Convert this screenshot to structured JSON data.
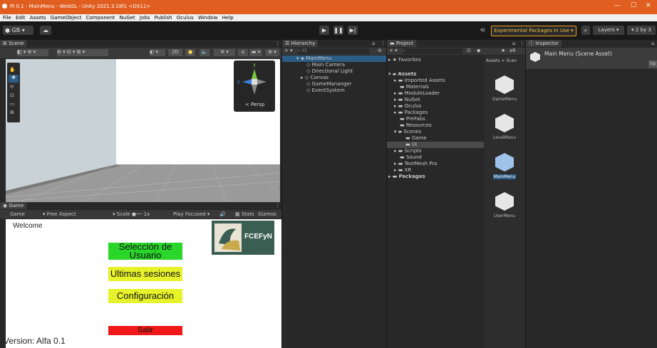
{
  "window": {
    "title": "PI 0.1 - MainMenu - WebGL - Unity 2021.3.18f1 <DX11>"
  },
  "menu": [
    "File",
    "Edit",
    "Assets",
    "GameObject",
    "Component",
    "NuGet",
    "Jobs",
    "Publish",
    "Oculus",
    "Window",
    "Help"
  ],
  "toolbar": {
    "account": "GB",
    "experimental": "Experimental Packages In Use",
    "layers": "Layers",
    "layout": "2 by 3"
  },
  "scene": {
    "tab": "Scene",
    "mode_2d": "2D",
    "persp": "Persp",
    "gizmo_y": "y",
    "gizmo_z": "z"
  },
  "game": {
    "tab": "Game",
    "display": "Game",
    "aspect": "Free Aspect",
    "scale_label": "Scale",
    "scale_value": "1x",
    "play_mode": "Play Focused",
    "stats": "Stats",
    "gizmos": "Gizmos",
    "welcome": "Welcome",
    "logo_text": "FCEFyN",
    "buttons": {
      "user_select": "Selección de Usuario",
      "sessions": "Ultimas sesiones",
      "config": "Configuración",
      "exit": "Salir"
    },
    "version": "Version: Alfa 0.1"
  },
  "hierarchy": {
    "tab": "Hierarchy",
    "search": "All",
    "root": "MainMenu",
    "items": [
      "Main Camera",
      "Directional Light",
      "Canvas",
      "GameMananger",
      "EventSystem"
    ]
  },
  "project": {
    "tab": "Project",
    "favorites": "Favorites",
    "assets": "Assets",
    "folders": [
      "Imported Assets",
      "Materials",
      "ModuleLoader",
      "NuGet",
      "Oculus",
      "Packages",
      "PreFabs",
      "Resources",
      "Scenes"
    ],
    "scene_folders": [
      "Game",
      "UI"
    ],
    "folders2": [
      "Scripts",
      "Sound",
      "TextMesh Pro",
      "XR"
    ],
    "packages": "Packages",
    "breadcrumb": "Assets > Scen",
    "hidden_count": "6",
    "scene_assets": [
      "GameMenu",
      "LevelMenu",
      "MainMenu",
      "UserMenu"
    ]
  },
  "inspector": {
    "tab": "Inspector",
    "title": "Main Menu (Scene Asset)",
    "open": "Op"
  }
}
